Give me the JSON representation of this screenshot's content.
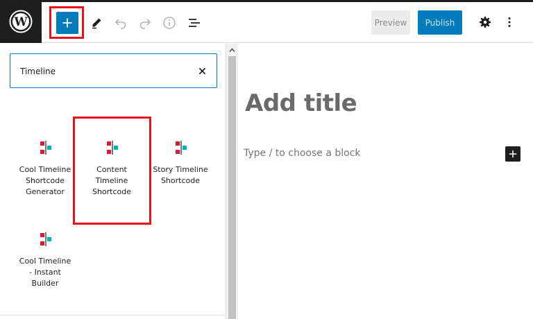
{
  "toolbar": {
    "preview_label": "Preview",
    "publish_label": "Publish"
  },
  "search": {
    "value": "Timeline"
  },
  "blocks": [
    {
      "label": "Cool Timeline\nShortcode\nGenerator",
      "icon": "timeline-block-icon"
    },
    {
      "label": "Content\nTimeline\nShortcode",
      "icon": "timeline-block-icon"
    },
    {
      "label": "Story Timeline\nShortcode",
      "icon": "timeline-block-icon"
    },
    {
      "label": "Cool Timeline\n- Instant\nBuilder",
      "icon": "timeline-block-icon"
    }
  ],
  "editor": {
    "title_placeholder": "Add title",
    "block_placeholder": "Type / to choose a block"
  },
  "colors": {
    "accent": "#007cba",
    "highlight": "#e6131b",
    "icon_red": "#d9183b",
    "icon_teal": "#00b1b5",
    "dark": "#1e1e1e"
  },
  "icons": {
    "logo": "wordpress-logo-icon",
    "inserter": "plus-icon",
    "tools": "pencil-icon",
    "undo": "undo-icon",
    "redo": "redo-icon",
    "details": "info-icon",
    "outline": "list-view-icon",
    "settings": "gear-icon",
    "options": "vertical-ellipsis-icon",
    "clear": "close-icon",
    "add_block": "plus-icon"
  }
}
